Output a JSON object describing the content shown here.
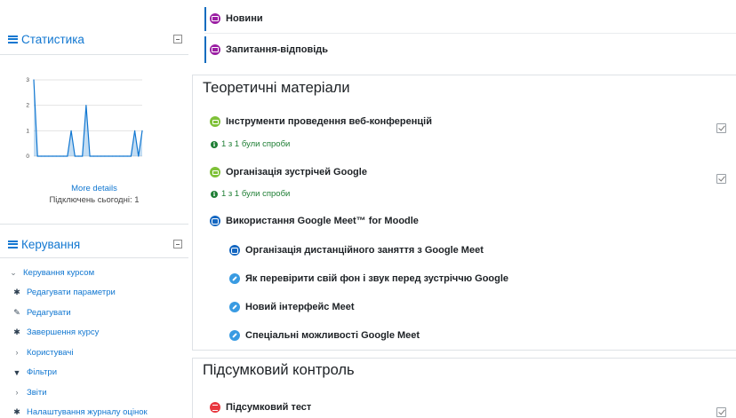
{
  "sidebar": {
    "stats_block": {
      "title": "Статистика",
      "more_details": "More details",
      "today_connections": "Підключень сьогодні: 1"
    },
    "manage_block": {
      "title": "Керування",
      "items": [
        {
          "label": "Керування курсом",
          "icon": "chevron-down-icon"
        },
        {
          "label": "Редагувати параметри",
          "icon": "gear-icon"
        },
        {
          "label": "Редагувати",
          "icon": "pencil-icon"
        },
        {
          "label": "Завершення курсу",
          "icon": "gear-icon"
        },
        {
          "label": "Користувачі",
          "icon": "chevron-right-icon"
        },
        {
          "label": "Фільтри",
          "icon": "filter-icon"
        },
        {
          "label": "Звіти",
          "icon": "chevron-right-icon"
        },
        {
          "label": "Налаштування журналу оцінок",
          "icon": "gear-icon"
        }
      ]
    }
  },
  "chart_data": {
    "type": "area",
    "x": [
      1,
      2,
      3,
      4,
      5,
      6,
      7,
      8,
      9,
      10,
      11,
      12,
      13,
      14,
      15,
      16,
      17,
      18,
      19,
      20,
      21,
      22,
      23,
      24,
      25,
      26,
      27,
      28,
      29,
      30
    ],
    "values": [
      3,
      0,
      0,
      0,
      0,
      0,
      0,
      0,
      0,
      0,
      1,
      0,
      0,
      0,
      2,
      0,
      0,
      0,
      0,
      0,
      0,
      0,
      0,
      0,
      0,
      0,
      0,
      1,
      0,
      1
    ],
    "yticks": [
      "0",
      "1",
      "2",
      "3"
    ],
    "ylim": [
      0,
      3
    ],
    "grid": true,
    "color": "#1177d1"
  },
  "main": {
    "top_activities": [
      {
        "label": "Новини",
        "icon": "forum-icon"
      },
      {
        "label": "Запитання-відповідь",
        "icon": "forum-icon"
      }
    ],
    "sections": [
      {
        "title": "Теоретичні матеріали",
        "activities": [
          {
            "label": "Інструменти проведення веб-конференцій",
            "info": "1 з 1 були спроби",
            "icon": "quiz-icon"
          },
          {
            "label": "Організація зустрічей Google",
            "info": "1 з 1 були спроби",
            "icon": "quiz-icon"
          },
          {
            "label": "Використання Google Meet™ for Moodle",
            "icon": "meet-icon"
          }
        ],
        "subitems": [
          {
            "label": "Організація дистанційного заняття з Google Meet",
            "icon": "meet-icon"
          },
          {
            "label": "Як перевірити свій фон і звук перед зустріччю Google",
            "icon": "link-icon"
          },
          {
            "label": "Новий інтерфейс Meet",
            "icon": "link-icon"
          },
          {
            "label": "Спеціальні можливості Google Meet",
            "icon": "link-icon"
          }
        ]
      },
      {
        "title": "Підсумковий контроль",
        "activities": [
          {
            "label": "Підсумковий тест",
            "icon": "test-icon"
          }
        ]
      }
    ]
  },
  "colors": {
    "accent": "#1177d1",
    "forum": "#9b1fa3",
    "quiz": "#7fc138",
    "meet": "#1467c1",
    "link": "#399be2",
    "test": "#e8373f",
    "attempt_text": "#1e7e34"
  }
}
